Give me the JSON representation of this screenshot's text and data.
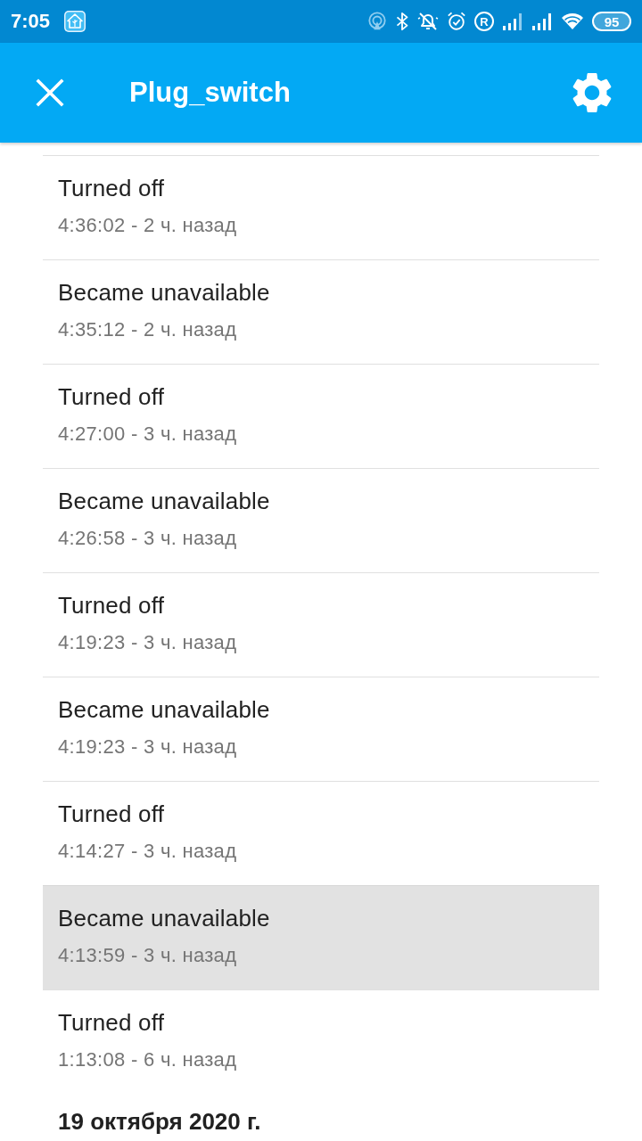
{
  "status_bar": {
    "time": "7:05",
    "roaming": "R",
    "battery": "95"
  },
  "app_bar": {
    "title": "Plug_switch"
  },
  "events": [
    {
      "title": "Turned off",
      "subtitle": "4:36:02 - 2 ч. назад",
      "selected": false
    },
    {
      "title": "Became unavailable",
      "subtitle": "4:35:12 - 2 ч. назад",
      "selected": false
    },
    {
      "title": "Turned off",
      "subtitle": "4:27:00 - 3 ч. назад",
      "selected": false
    },
    {
      "title": "Became unavailable",
      "subtitle": "4:26:58 - 3 ч. назад",
      "selected": false
    },
    {
      "title": "Turned off",
      "subtitle": "4:19:23 - 3 ч. назад",
      "selected": false
    },
    {
      "title": "Became unavailable",
      "subtitle": "4:19:23 - 3 ч. назад",
      "selected": false
    },
    {
      "title": "Turned off",
      "subtitle": "4:14:27 - 3 ч. назад",
      "selected": false
    },
    {
      "title": "Became unavailable",
      "subtitle": "4:13:59 - 3 ч. назад",
      "selected": true
    },
    {
      "title": "Turned off",
      "subtitle": "1:13:08 - 6 ч. назад",
      "selected": false
    }
  ],
  "date_header": "19 октября 2020 г."
}
